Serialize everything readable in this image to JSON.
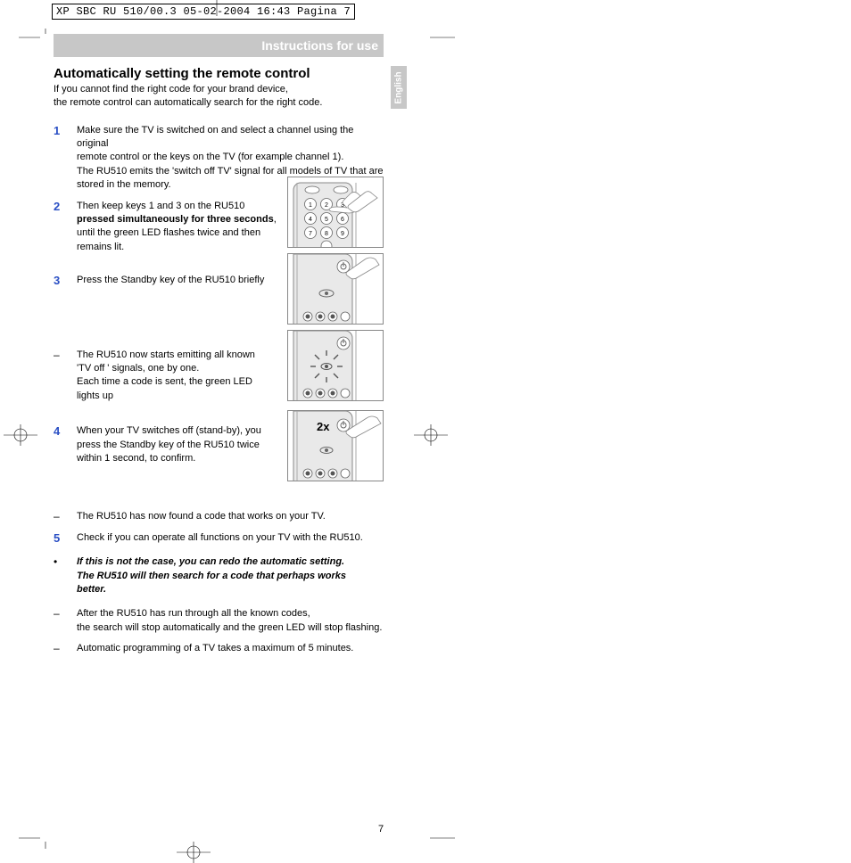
{
  "header_info": "XP SBC RU 510/00.3  05-02-2004  16:43  Pagina 7",
  "title_band": "Instructions for use",
  "lang_tab": "English",
  "heading": "Automatically setting the remote control",
  "intro_line1": "If you cannot find the right code for your brand device,",
  "intro_line2": "the remote control can automatically search for the right code.",
  "step1": {
    "num": "1",
    "l1": "Make sure the TV is switched on and select a channel using the original",
    "l2": "remote control or the keys on the TV (for example channel 1).",
    "l3": "The RU510 emits the 'switch off TV' signal for all models of TV that are",
    "l4": "stored in the memory."
  },
  "step2": {
    "num": "2",
    "l1": "Then keep keys 1 and 3 on the RU510",
    "l2a": "pressed simultaneously for three seconds",
    "l2b": ",",
    "l3": "until the green LED flashes twice and then",
    "l4": "remains lit."
  },
  "step3": {
    "num": "3",
    "l1": "Press the Standby key of the RU510 briefly"
  },
  "dashA": {
    "mark": "–",
    "l1": "The RU510 now starts emitting all known",
    "l2": "'TV off ' signals, one by one.",
    "l3": "Each time a code is sent, the green LED",
    "l4": "lights up"
  },
  "step4": {
    "num": "4",
    "l1": "When your TV switches off (stand-by), you",
    "l2": "press the Standby key of the RU510 twice",
    "l3": "within 1 second, to confirm."
  },
  "dashB": {
    "mark": "–",
    "l1": "The RU510 has now found a code that works on your TV."
  },
  "step5": {
    "num": "5",
    "l1": "Check if you can operate all functions on your TV with the RU510."
  },
  "bullet": {
    "mark": "•",
    "l1": "If this is not the case, you can redo the automatic setting.",
    "l2": "The RU510 will then search for a code that perhaps works",
    "l3": "better."
  },
  "dashC": {
    "mark": "–",
    "l1": "After the RU510 has run through all the known codes,",
    "l2": "the search will stop automatically and the green LED will stop flashing."
  },
  "dashD": {
    "mark": "–",
    "l1": "Automatic programming of a TV takes a maximum of 5 minutes."
  },
  "fig4_label": "2x",
  "page_number": "7"
}
